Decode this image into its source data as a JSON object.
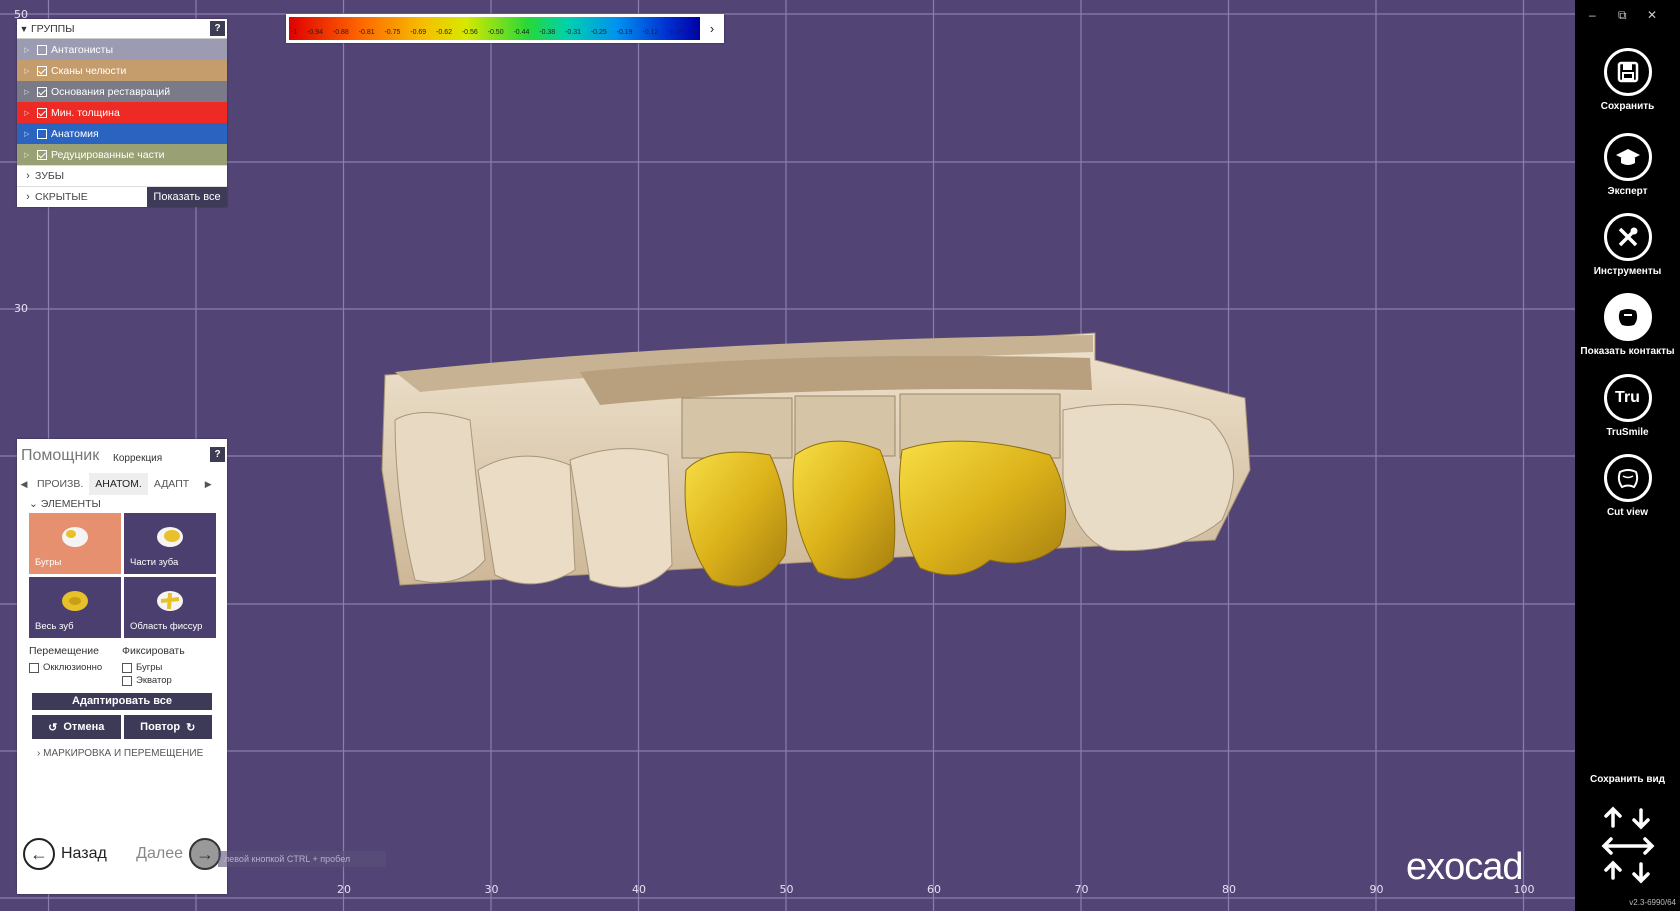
{
  "groups": {
    "title": "ГРУППЫ",
    "help": "?",
    "items": [
      {
        "label": "Антагонисты",
        "checked": false,
        "color": "#9b9bb2"
      },
      {
        "label": "Сканы челюсти",
        "checked": true,
        "color": "#c59c6c"
      },
      {
        "label": "Основания реставраций",
        "checked": true,
        "color": "#7a7a88"
      },
      {
        "label": "Мин. толщина",
        "checked": true,
        "color": "#ee2a24"
      },
      {
        "label": "Анатомия",
        "checked": false,
        "color": "#2b63c0"
      },
      {
        "label": "Редуцированные части",
        "checked": true,
        "color": "#98a074"
      }
    ],
    "teeth_label": "ЗУБЫ",
    "hidden_label": "СКРЫТЫЕ",
    "show_all": "Показать все"
  },
  "colorbar": {
    "labels": [
      "-1",
      "-0.94",
      "-0.88",
      "-0.81",
      "-0.75",
      "-0.69",
      "-0.62",
      "-0.56",
      "-0.50",
      "-0.44",
      "-0.38",
      "-0.31",
      "-0.25",
      "-0.19",
      "-0.12",
      "-0.06",
      "0"
    ]
  },
  "assistant": {
    "title": "Помощник",
    "subtitle": "Коррекция",
    "help": "?",
    "tabs": [
      "ПРОИЗВ.",
      "АНАТОМ.",
      "АДАПТ"
    ],
    "section": "ЭЛЕМЕНТЫ",
    "tiles": [
      {
        "label": "Бугры",
        "selected": true
      },
      {
        "label": "Части зуба",
        "selected": false
      },
      {
        "label": "Весь зуб",
        "selected": false
      },
      {
        "label": "Область фиссур",
        "selected": false
      }
    ],
    "move_label": "Перемещение",
    "fix_label": "Фиксировать",
    "occlusal": "Окклюзионно",
    "cusps": "Бугры",
    "equator": "Экватор",
    "adapt_all": "Адаптировать все",
    "undo": "Отмена",
    "redo": "Повтор",
    "marking": "МАРКИРОВКА И ПЕРЕМЕЩЕНИЕ",
    "back": "Назад",
    "next": "Далее",
    "tooltip": "левой кнопкой CTRL + пробел"
  },
  "toolbar": {
    "save": "Сохранить",
    "expert": "Эксперт",
    "tools": "Инструменты",
    "contacts": "Показать контакты",
    "trusmile": "TruSmile",
    "trusmile_icon_text": "Tru",
    "cutview": "Cut view",
    "save_view": "Сохранить вид",
    "version": "v2.3-6990/64",
    "minimize": "–",
    "restore": "⧉",
    "close": "✕"
  },
  "viewport": {
    "axis_y_labels": [
      "50",
      "30"
    ],
    "axis_x_labels": [
      "20",
      "30",
      "40",
      "50",
      "60",
      "70",
      "80",
      "90",
      "100"
    ],
    "logo": "exocad"
  },
  "colors": {
    "background": "#534476",
    "grid": "#8a7fb0",
    "tooth": "#dccbb2",
    "crown": "#e2bb1e",
    "panel_dark": "#3c3a57",
    "tile_selected": "#e79070"
  }
}
